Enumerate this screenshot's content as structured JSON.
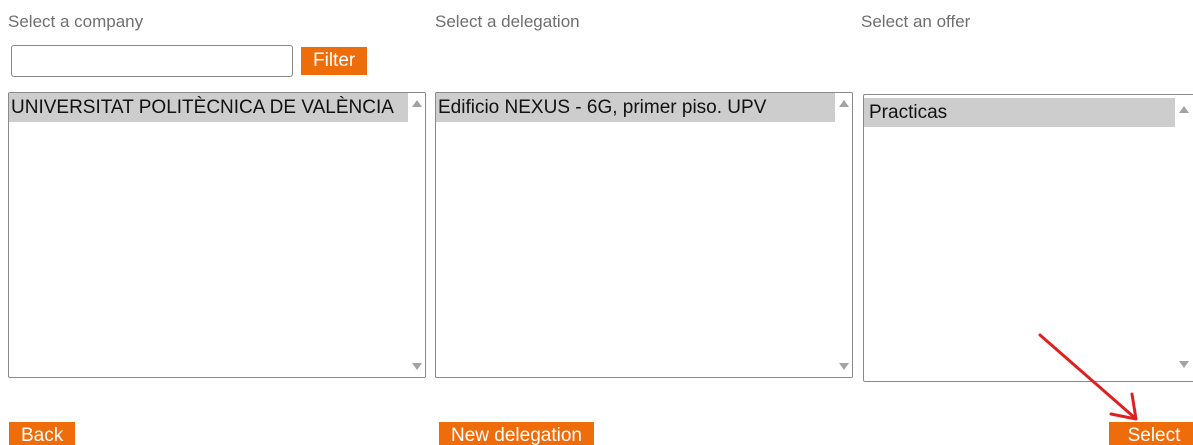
{
  "company_column": {
    "label": "Select a company",
    "filter_value": "",
    "filter_placeholder": "",
    "filter_button": "Filter",
    "items": [
      {
        "label": "UNIVERSITAT POLITÈCNICA DE VALÈNCIA",
        "selected": true
      }
    ]
  },
  "delegation_column": {
    "label": "Select a delegation",
    "items": [
      {
        "label": "Edificio NEXUS - 6G, primer piso. UPV",
        "selected": true
      }
    ]
  },
  "offer_column": {
    "label": "Select an offer",
    "items": [
      {
        "label": "Practicas",
        "selected": true
      }
    ]
  },
  "actions": {
    "back": "Back",
    "new_delegation": "New delegation",
    "select": "Select"
  },
  "colors": {
    "accent": "#ef6c0b",
    "selection": "#cdcdcd",
    "annotation_arrow": "#e02020"
  },
  "icons": {
    "scroll_up": "triangle-up",
    "scroll_down": "triangle-down",
    "annotation": "red-arrow"
  }
}
